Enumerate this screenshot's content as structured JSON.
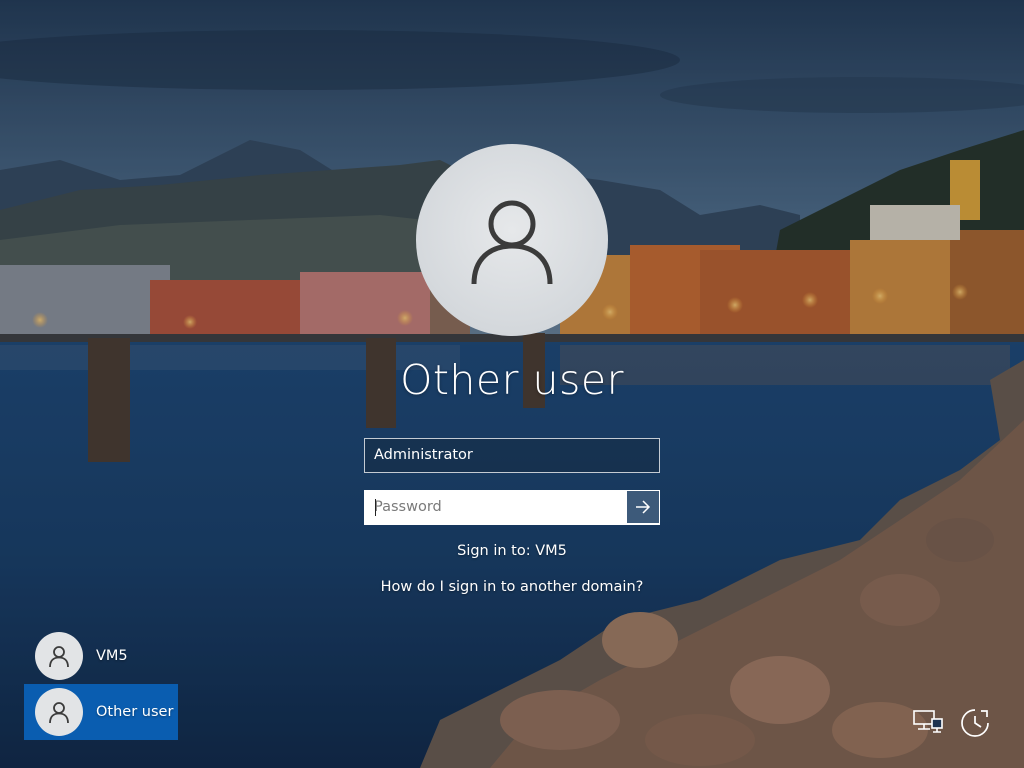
{
  "screen": "Windows sign-in",
  "selected_user": {
    "name": "Other user"
  },
  "form": {
    "username_value": "Administrator",
    "password_placeholder": "Password",
    "submit_icon": "arrow-right-icon"
  },
  "sign_in_to": "Sign in to: VM5",
  "domain_help_link": "How do I sign in to another domain?",
  "user_list": [
    {
      "name": "VM5",
      "selected": false
    },
    {
      "name": "Other user",
      "selected": true
    }
  ],
  "system_icons": [
    "network-icon",
    "accessibility-icon"
  ],
  "colors": {
    "selected_tile": "#0a5db0",
    "submit_button": "#3d5a7a"
  }
}
